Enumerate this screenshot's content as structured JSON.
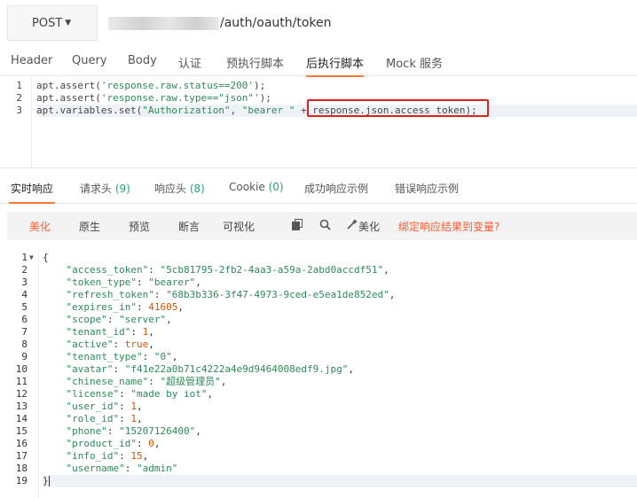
{
  "request": {
    "method": "POST",
    "url_suffix": "/auth/oauth/token"
  },
  "request_tabs": [
    {
      "label": "Header"
    },
    {
      "label": "Query"
    },
    {
      "label": "Body"
    },
    {
      "label": "认证"
    },
    {
      "label": "预执行脚本"
    },
    {
      "label": "后执行脚本"
    },
    {
      "label": "Mock 服务"
    }
  ],
  "script": {
    "lines": [
      {
        "num": "1",
        "parts": [
          "apt.assert(",
          "'response.raw.status==200'",
          ");"
        ]
      },
      {
        "num": "2",
        "parts": [
          "apt.assert(",
          "'response.raw.type==\"json\"'",
          ");"
        ]
      },
      {
        "num": "3",
        "parts": [
          "apt.variables.set(",
          "\"Authorization\"",
          ", ",
          "\"bearer \"",
          " + ",
          "response.json.access_token);"
        ]
      }
    ]
  },
  "response_tabs": [
    {
      "label": "实时响应",
      "count": ""
    },
    {
      "label": "请求头",
      "count": "(9)"
    },
    {
      "label": "响应头",
      "count": "(8)"
    },
    {
      "label": "Cookie",
      "count": "(0)"
    },
    {
      "label": "成功响应示例",
      "count": ""
    },
    {
      "label": "错误响应示例",
      "count": ""
    }
  ],
  "toolbar": {
    "views": [
      "美化",
      "原生",
      "预览",
      "断言",
      "可视化"
    ],
    "beautify_label": "美化",
    "bind_label": "绑定响应结果到变量?"
  },
  "response_json": {
    "open": "{",
    "close": "}",
    "fields": [
      {
        "key": "\"access_token\"",
        "value": "\"5cb81795-2fb2-4aa3-a59a-2abd0accdf51\"",
        "type": "string"
      },
      {
        "key": "\"token_type\"",
        "value": "\"bearer\"",
        "type": "string"
      },
      {
        "key": "\"refresh_token\"",
        "value": "\"68b3b336-3f47-4973-9ced-e5ea1de852ed\"",
        "type": "string"
      },
      {
        "key": "\"expires_in\"",
        "value": "41605",
        "type": "number"
      },
      {
        "key": "\"scope\"",
        "value": "\"server\"",
        "type": "string"
      },
      {
        "key": "\"tenant_id\"",
        "value": "1",
        "type": "number"
      },
      {
        "key": "\"active\"",
        "value": "true",
        "type": "bool"
      },
      {
        "key": "\"tenant_type\"",
        "value": "\"0\"",
        "type": "string"
      },
      {
        "key": "\"avatar\"",
        "value": "\"f41e22a0b71c4222a4e9d9464008edf9.jpg\"",
        "type": "string"
      },
      {
        "key": "\"chinese_name\"",
        "value": "\"超级管理员\"",
        "type": "string"
      },
      {
        "key": "\"license\"",
        "value": "\"made by iot\"",
        "type": "string"
      },
      {
        "key": "\"user_id\"",
        "value": "1",
        "type": "number"
      },
      {
        "key": "\"role_id\"",
        "value": "1",
        "type": "number"
      },
      {
        "key": "\"phone\"",
        "value": "\"15207126400\"",
        "type": "string"
      },
      {
        "key": "\"product_id\"",
        "value": "0",
        "type": "number"
      },
      {
        "key": "\"info_id\"",
        "value": "15",
        "type": "number"
      },
      {
        "key": "\"username\"",
        "value": "\"admin\"",
        "type": "string"
      }
    ]
  },
  "colors": {
    "accent": "#ff7733",
    "string": "#2e8b57",
    "number": "#d35400",
    "highlight_box": "#e02020"
  }
}
